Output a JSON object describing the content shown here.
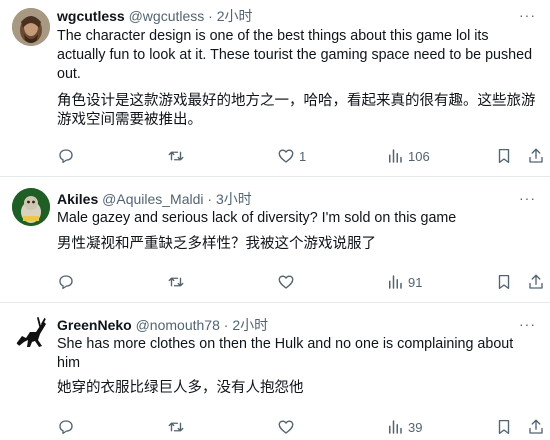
{
  "posts": [
    {
      "name": "wgcutless",
      "handle": "@wgcutless",
      "sep": "·",
      "time": "2小时",
      "text": "The character design is one of the best things about this game lol its actually fun to look at it. These tourist the gaming space need to be pushed out.",
      "translation": "角色设计是这款游戏最好的地方之一，哈哈，看起来真的很有趣。这些旅游游戏空间需要被推出。",
      "likes": "1",
      "views": "106"
    },
    {
      "name": "Akiles",
      "handle": "@Aquiles_Maldi",
      "sep": "·",
      "time": "3小时",
      "text": "Male gazey and serious lack of diversity? I'm sold on this game",
      "translation": "男性凝视和严重缺乏多样性？我被这个游戏说服了",
      "likes": "",
      "views": "91"
    },
    {
      "name": "GreenNeko",
      "handle": "@nomouth78",
      "sep": "·",
      "time": "2小时",
      "text": "She has more clothes on then the Hulk and no one is complaining about him",
      "translation": "她穿的衣服比绿巨人多，没有人抱怨他",
      "likes": "",
      "views": "39"
    }
  ],
  "more_label": "···",
  "colors": {
    "text": "#0f1419",
    "secondary": "#536471",
    "divider": "#e6e9ec"
  }
}
